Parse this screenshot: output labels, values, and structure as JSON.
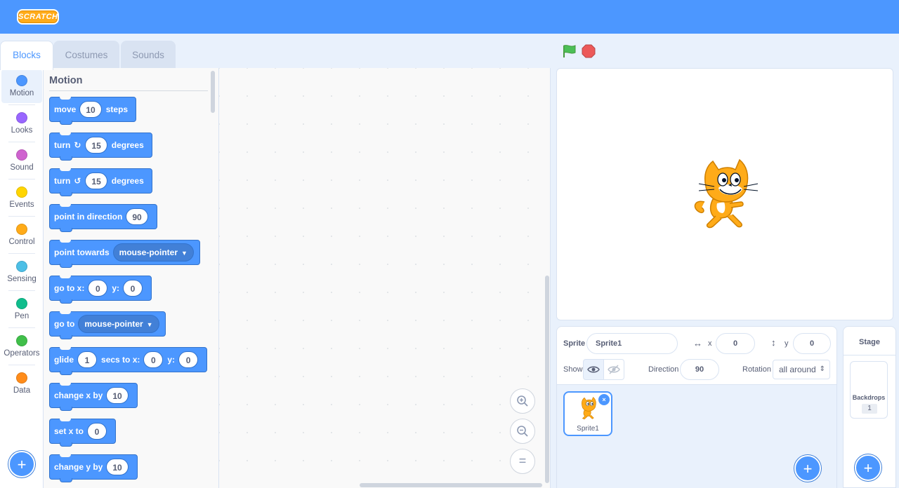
{
  "app": {
    "logo_text": "SCRATCH"
  },
  "tabs": [
    {
      "label": "Blocks",
      "active": true
    },
    {
      "label": "Costumes",
      "active": false
    },
    {
      "label": "Sounds",
      "active": false
    }
  ],
  "categories": [
    {
      "label": "Motion",
      "color": "#4c97ff",
      "selected": true
    },
    {
      "label": "Looks",
      "color": "#9966ff"
    },
    {
      "label": "Sound",
      "color": "#cf63cf"
    },
    {
      "label": "Events",
      "color": "#ffd500"
    },
    {
      "label": "Control",
      "color": "#ffab19"
    },
    {
      "label": "Sensing",
      "color": "#4cbfe6"
    },
    {
      "label": "Pen",
      "color": "#0fbd8c"
    },
    {
      "label": "Operators",
      "color": "#40bf4a"
    },
    {
      "label": "Data",
      "color": "#ff8c1a"
    }
  ],
  "palette": {
    "title": "Motion",
    "blocks": {
      "move": {
        "t1": "move",
        "v1": "10",
        "t2": "steps"
      },
      "turn_right": {
        "t1": "turn",
        "v1": "15",
        "t2": "degrees"
      },
      "turn_left": {
        "t1": "turn",
        "v1": "15",
        "t2": "degrees"
      },
      "point_dir": {
        "t1": "point in direction",
        "v1": "90"
      },
      "point_towards": {
        "t1": "point towards",
        "menu": "mouse-pointer"
      },
      "goto_xy": {
        "t1": "go to x:",
        "v1": "0",
        "t2": "y:",
        "v2": "0"
      },
      "goto": {
        "t1": "go to",
        "menu": "mouse-pointer"
      },
      "glide": {
        "t1": "glide",
        "v1": "1",
        "t2": "secs to x:",
        "v2": "0",
        "t3": "y:",
        "v3": "0"
      },
      "change_x": {
        "t1": "change x by",
        "v1": "10"
      },
      "set_x": {
        "t1": "set x to",
        "v1": "0"
      },
      "change_y": {
        "t1": "change y by",
        "v1": "10"
      }
    }
  },
  "workspace": {
    "zoom_reset": "="
  },
  "sprite_info": {
    "sprite_label": "Sprite",
    "sprite_name": "Sprite1",
    "x_label": "x",
    "x_value": "0",
    "y_label": "y",
    "y_value": "0",
    "show_label": "Show",
    "direction_label": "Direction",
    "direction_value": "90",
    "rotation_label": "Rotation",
    "rotation_value": "all around"
  },
  "sprites": [
    {
      "name": "Sprite1",
      "delete": "×"
    }
  ],
  "stage_pane": {
    "title": "Stage",
    "backdrops_label": "Backdrops",
    "backdrops_count": "1"
  },
  "buttons": {
    "add": "+"
  },
  "colors": {
    "motion": "#4c97ff",
    "menubar": "#4c97ff",
    "flag": "#4cbf56",
    "stop": "#ec5959"
  }
}
